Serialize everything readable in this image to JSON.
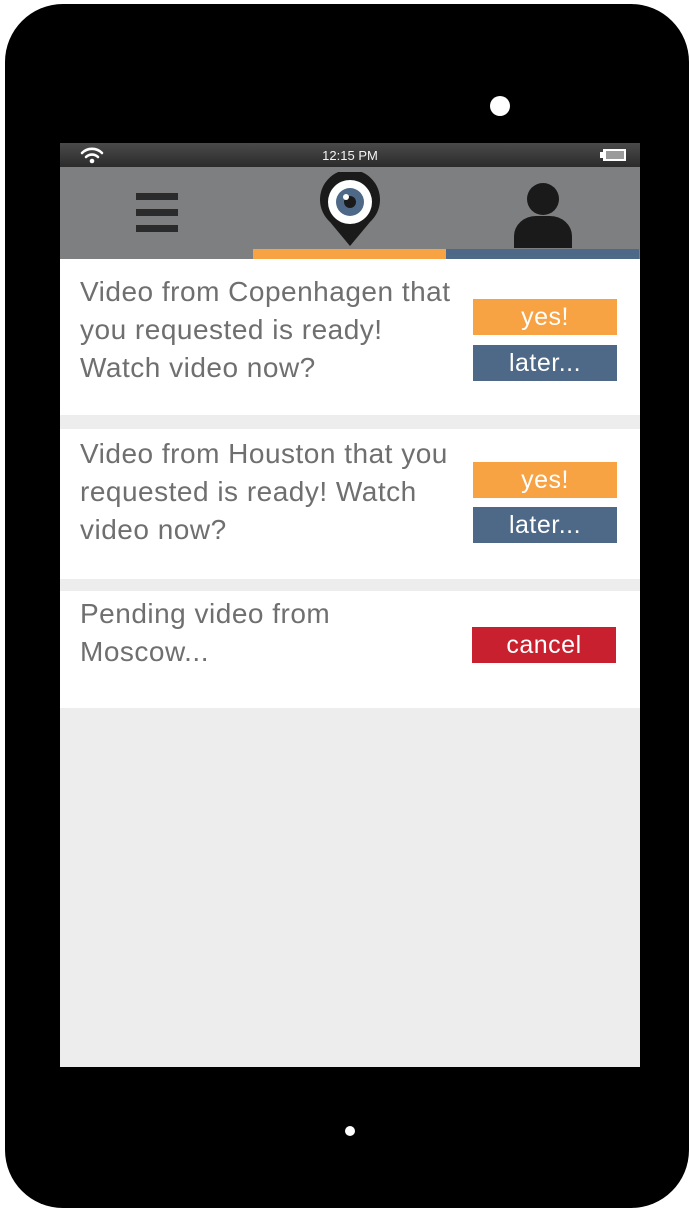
{
  "status_bar": {
    "time": "12:15 PM",
    "wifi_icon": "wifi-icon",
    "battery_icon": "battery-icon"
  },
  "app_bar": {
    "tabs": [
      {
        "icon": "hamburger-menu-icon",
        "active": false
      },
      {
        "icon": "eye-location-pin-icon",
        "active": true,
        "indicator_color": "#f7a343"
      },
      {
        "icon": "user-profile-icon",
        "active": false,
        "indicator_color": "#4d6987"
      }
    ]
  },
  "notifications": [
    {
      "message": "Video from Copenhagen that you requested is ready! Watch video now?",
      "actions": {
        "yes": "yes!",
        "later": "later..."
      }
    },
    {
      "message": "Video from Houston that you requested is ready! Watch video now?",
      "actions": {
        "yes": "yes!",
        "later": "later..."
      }
    },
    {
      "message": "Pending video from Moscow...",
      "actions": {
        "cancel": "cancel"
      }
    }
  ],
  "colors": {
    "accent_orange": "#f7a343",
    "accent_blue": "#4d6987",
    "cancel_red": "#c8202e",
    "app_bar_gray": "#7e7f80"
  }
}
